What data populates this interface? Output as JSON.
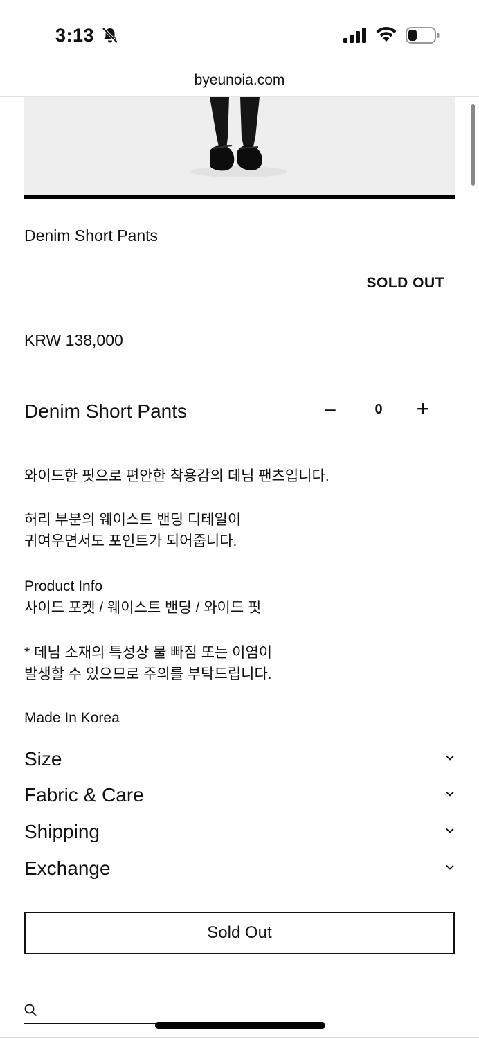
{
  "status_bar": {
    "time": "3:13"
  },
  "browser": {
    "url": "byeunoia.com"
  },
  "product": {
    "title": "Denim Short Pants",
    "badge": "SOLD OUT",
    "price": "KRW 138,000"
  },
  "option": {
    "name": "Denim Short Pants",
    "quantity": "0",
    "minus": "−",
    "plus": "+"
  },
  "description": {
    "line1": "와이드한 핏으로 편안한 착용감의 데님 팬츠입니다.",
    "line2": "허리 부분의 웨이스트 밴딩 디테일이",
    "line3": "귀여우면서도 포인트가 되어줍니다.",
    "info_heading": "Product Info",
    "info_body": "사이드 포켓 / 웨이스트 밴딩 / 와이드 핏",
    "note1": "* 데님 소재의 특성상 물 빠짐 또는 이염이",
    "note2": "발생할 수 있으므로 주의를 부탁드립니다.",
    "origin": "Made In Korea"
  },
  "accordion": [
    {
      "label": "Size"
    },
    {
      "label": "Fabric & Care"
    },
    {
      "label": "Shipping"
    },
    {
      "label": "Exchange"
    }
  ],
  "cta": {
    "label": "Sold Out"
  },
  "icons": [
    "bell-slash-icon",
    "signal-icon",
    "wifi-icon",
    "battery-icon",
    "chevron-down-icon",
    "search-icon"
  ]
}
